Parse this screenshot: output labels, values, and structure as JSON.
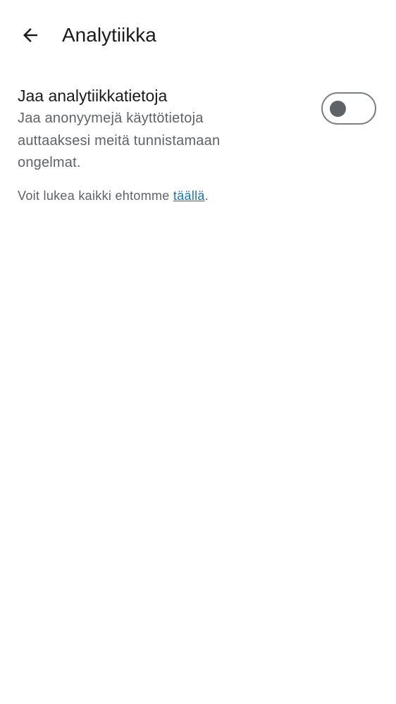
{
  "header": {
    "title": "Analytiikka",
    "back_icon": "arrow-left-icon"
  },
  "analytics_setting": {
    "title": "Jaa analytiikkatietoja",
    "description": "Jaa anonyymejä käyttötietoja auttaaksesi meitä tunnistamaan ongelmat.",
    "enabled": false
  },
  "terms": {
    "prefix": "Voit lukea kaikki ehtomme ",
    "link_label": "täällä",
    "suffix": "."
  },
  "colors": {
    "link": "#1a73b8",
    "secondary_text": "#5f6268",
    "toggle_outline": "#7b7e85"
  }
}
